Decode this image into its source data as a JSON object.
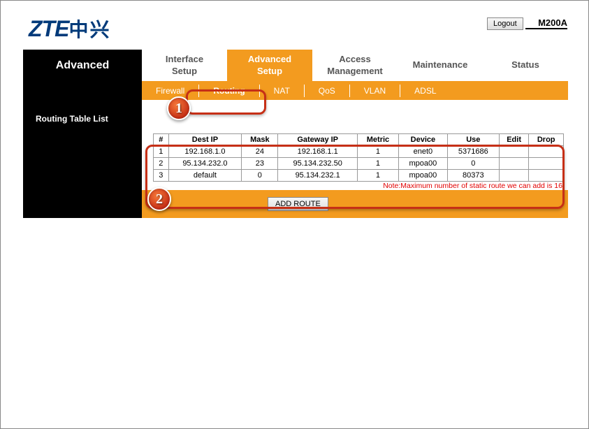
{
  "header": {
    "logo_lat": "ZTE",
    "logo_cn": "中兴",
    "logout_label": "Logout",
    "model": "M200A"
  },
  "section_label": "Advanced",
  "main_tabs": [
    {
      "line1": "Interface",
      "line2": "Setup"
    },
    {
      "line1": "Advanced",
      "line2": "Setup"
    },
    {
      "line1": "Access",
      "line2": "Management"
    },
    {
      "line1": "Maintenance",
      "line2": ""
    },
    {
      "line1": "Status",
      "line2": ""
    }
  ],
  "active_main_tab": 1,
  "sub_tabs": [
    "Firewall",
    "Routing",
    "NAT",
    "QoS",
    "VLAN",
    "ADSL"
  ],
  "active_sub_tab": 1,
  "list_title": "Routing Table List",
  "table": {
    "columns": [
      "#",
      "Dest IP",
      "Mask",
      "Gateway IP",
      "Metric",
      "Device",
      "Use",
      "Edit",
      "Drop"
    ],
    "rows": [
      {
        "n": "1",
        "dest": "192.168.1.0",
        "mask": "24",
        "gw": "192.168.1.1",
        "metric": "1",
        "device": "enet0",
        "use": "5371686",
        "edit": "",
        "drop": ""
      },
      {
        "n": "2",
        "dest": "95.134.232.0",
        "mask": "23",
        "gw": "95.134.232.50",
        "metric": "1",
        "device": "mpoa00",
        "use": "0",
        "edit": "",
        "drop": ""
      },
      {
        "n": "3",
        "dest": "default",
        "mask": "0",
        "gw": "95.134.232.1",
        "metric": "1",
        "device": "mpoa00",
        "use": "80373",
        "edit": "",
        "drop": ""
      }
    ]
  },
  "note": "Note:Maximum number of static route we can add is 16",
  "add_route_label": "ADD ROUTE",
  "badges": {
    "b1": "1",
    "b2": "2"
  }
}
